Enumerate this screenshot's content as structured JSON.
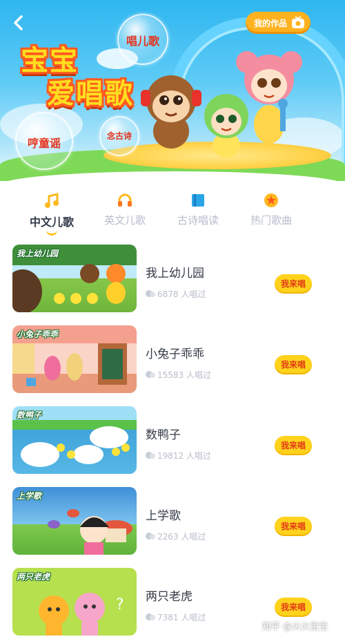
{
  "header": {
    "my_works_label": "我的作品",
    "title_line1": "宝宝",
    "title_line2": "爱唱歌",
    "bubbles": {
      "top": "唱儿歌",
      "left": "哼童谣",
      "small": "念古诗"
    }
  },
  "tabs": [
    {
      "label": "中文儿歌",
      "icon": "music-note-icon"
    },
    {
      "label": "英文儿歌",
      "icon": "headphones-icon"
    },
    {
      "label": "古诗唱读",
      "icon": "book-icon"
    },
    {
      "label": "热门歌曲",
      "icon": "star-icon"
    }
  ],
  "active_tab": "中文儿歌",
  "songs": [
    {
      "thumb_title": "我上幼儿园",
      "title": "我上幼儿园",
      "count": "6878 人唱过",
      "button": "我来唱"
    },
    {
      "thumb_title": "小兔子乖乖",
      "title": "小兔子乖乖",
      "count": "15583 人唱过",
      "button": "我来唱"
    },
    {
      "thumb_title": "数鸭子",
      "title": "数鸭子",
      "count": "19812 人唱过",
      "button": "我来唱"
    },
    {
      "thumb_title": "上学歌",
      "title": "上学歌",
      "count": "2263 人唱过",
      "button": "我来唱"
    },
    {
      "thumb_title": "两只老虎",
      "title": "两只老虎",
      "count": "7381 人唱过",
      "button": "我来唱"
    }
  ],
  "watermark": "知乎 @火火宝宝",
  "colors": {
    "accent_yellow": "#ffd21c",
    "button_text": "#e23c16",
    "header_blue": "#2fb6f0",
    "active_tab_text": "#333b4a",
    "inactive_tab_text": "#b6bccb"
  }
}
